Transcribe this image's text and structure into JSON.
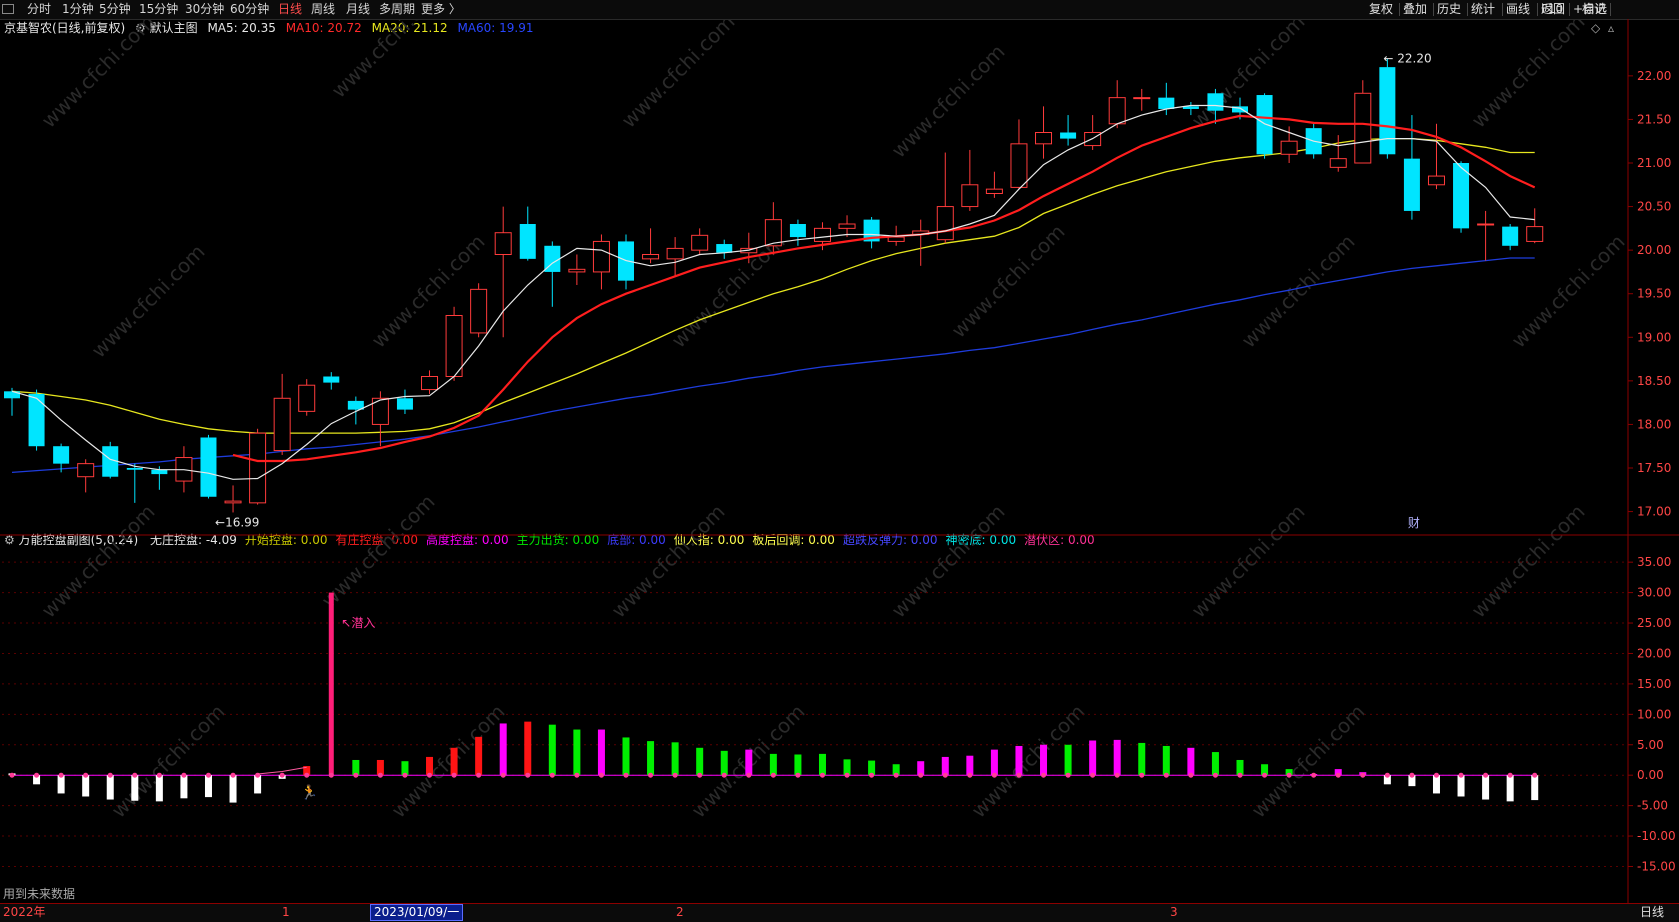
{
  "toolbar": {
    "tabs": [
      "分时",
      "1分钟",
      "5分钟",
      "15分钟",
      "30分钟",
      "60分钟",
      "日线",
      "周线",
      "月线",
      "多周期",
      "更多 〉"
    ],
    "active_tab": "日线",
    "right_buttons": [
      "复权",
      "叠加",
      "历史",
      "统计",
      "画线",
      "F10",
      "+自选",
      "返回"
    ],
    "extra_button": "标记"
  },
  "main_legend": {
    "stock": "京基智农(日线,前复权)",
    "template": "默认主图",
    "ma5_label": "MA5: 20.35",
    "ma10_label": "MA10: 20.72",
    "ma20_label": "MA20: 21.12",
    "ma60_label": "MA60: 19.91"
  },
  "colors": {
    "up": "#ff3b3b",
    "down": "#00e5ff",
    "ma5": "#e8e8e8",
    "ma10": "#ff1e1e",
    "ma20": "#e6e61e",
    "ma60": "#1e3cdc",
    "axis": "#8b0000",
    "axis_text": "#ff4646",
    "green_bar": "#00f000",
    "magenta_bar": "#ff00ff",
    "red_bar": "#ff1414"
  },
  "sub_legend": {
    "name": "万能控盘副图(5,0.24)",
    "items": [
      {
        "label": "无庄控盘: -4.09",
        "color": "#e6e6e6"
      },
      {
        "label": "开始控盘: 0.00",
        "color": "#c8c800"
      },
      {
        "label": "有庄控盘: 0.00",
        "color": "#ff2020"
      },
      {
        "label": "高度控盘: 0.00",
        "color": "#ff00ff"
      },
      {
        "label": "主力出货: 0.00",
        "color": "#00e600"
      },
      {
        "label": "底部: 0.00",
        "color": "#3c3cff"
      },
      {
        "label": "仙人指: 0.00",
        "color": "#ffff50"
      },
      {
        "label": "板后回调: 0.00",
        "color": "#ffff50"
      },
      {
        "label": "超跌反弹力: 0.00",
        "color": "#4646ff"
      },
      {
        "label": "神密底: 0.00",
        "color": "#00e6e6"
      },
      {
        "label": "潜伏区: 0.00",
        "color": "#ff3296"
      }
    ]
  },
  "annotations": {
    "high_label": "22.20",
    "low_label": "←16.99",
    "cai_badge": "财",
    "qianru": "↖潜入",
    "future_data": "用到未来数据"
  },
  "watermark": "www.cfchi.com",
  "bottom_bar": {
    "year": "2022年",
    "m1": "1",
    "date_box": "2023/01/09/一",
    "m2": "2",
    "m3": "3",
    "period": "日线"
  },
  "chart_data": [
    {
      "type": "candlestick",
      "title": "京基智农(日线,前复权)",
      "ylim": [
        16.8,
        22.4
      ],
      "yticks": [
        "17.00",
        "17.50",
        "18.00",
        "18.50",
        "19.00",
        "19.50",
        "20.00",
        "20.50",
        "21.00",
        "21.50",
        "22.00"
      ],
      "candles": [
        {
          "o": 18.38,
          "c": 18.3,
          "h": 18.42,
          "l": 18.1
        },
        {
          "o": 18.35,
          "c": 17.75,
          "h": 18.4,
          "l": 17.7
        },
        {
          "o": 17.75,
          "c": 17.55,
          "h": 17.78,
          "l": 17.45
        },
        {
          "o": 17.4,
          "c": 17.55,
          "h": 17.6,
          "l": 17.22
        },
        {
          "o": 17.75,
          "c": 17.4,
          "h": 17.8,
          "l": 17.38
        },
        {
          "o": 17.5,
          "c": 17.48,
          "h": 17.55,
          "l": 17.1
        },
        {
          "o": 17.48,
          "c": 17.43,
          "h": 17.52,
          "l": 17.25
        },
        {
          "o": 17.35,
          "c": 17.62,
          "h": 17.75,
          "l": 17.22
        },
        {
          "o": 17.85,
          "c": 17.17,
          "h": 17.88,
          "l": 17.15
        },
        {
          "o": 17.1,
          "c": 17.12,
          "h": 17.3,
          "l": 16.99
        },
        {
          "o": 17.1,
          "c": 17.9,
          "h": 17.95,
          "l": 17.08
        },
        {
          "o": 17.7,
          "c": 18.3,
          "h": 18.58,
          "l": 17.65
        },
        {
          "o": 18.15,
          "c": 18.45,
          "h": 18.52,
          "l": 18.1
        },
        {
          "o": 18.55,
          "c": 18.48,
          "h": 18.6,
          "l": 18.4
        },
        {
          "o": 18.27,
          "c": 18.17,
          "h": 18.32,
          "l": 18.0
        },
        {
          "o": 18.0,
          "c": 18.3,
          "h": 18.38,
          "l": 17.75
        },
        {
          "o": 18.3,
          "c": 18.17,
          "h": 18.4,
          "l": 18.12
        },
        {
          "o": 18.4,
          "c": 18.55,
          "h": 18.62,
          "l": 18.35
        },
        {
          "o": 18.55,
          "c": 19.25,
          "h": 19.35,
          "l": 18.5
        },
        {
          "o": 19.05,
          "c": 19.55,
          "h": 19.62,
          "l": 19.0
        },
        {
          "o": 19.95,
          "c": 20.2,
          "h": 20.5,
          "l": 19.0
        },
        {
          "o": 20.3,
          "c": 19.9,
          "h": 20.5,
          "l": 19.88
        },
        {
          "o": 20.05,
          "c": 19.75,
          "h": 20.1,
          "l": 19.35
        },
        {
          "o": 19.75,
          "c": 19.78,
          "h": 19.95,
          "l": 19.6
        },
        {
          "o": 19.75,
          "c": 20.1,
          "h": 20.18,
          "l": 19.55
        },
        {
          "o": 20.1,
          "c": 19.65,
          "h": 20.18,
          "l": 19.55
        },
        {
          "o": 19.9,
          "c": 19.95,
          "h": 20.25,
          "l": 19.85
        },
        {
          "o": 19.9,
          "c": 20.02,
          "h": 20.15,
          "l": 19.7
        },
        {
          "o": 20.0,
          "c": 20.17,
          "h": 20.25,
          "l": 19.95
        },
        {
          "o": 20.07,
          "c": 19.97,
          "h": 20.12,
          "l": 19.9
        },
        {
          "o": 19.97,
          "c": 20.02,
          "h": 20.2,
          "l": 19.85
        },
        {
          "o": 20.05,
          "c": 20.35,
          "h": 20.55,
          "l": 19.95
        },
        {
          "o": 20.3,
          "c": 20.15,
          "h": 20.35,
          "l": 20.05
        },
        {
          "o": 20.1,
          "c": 20.25,
          "h": 20.32,
          "l": 20.0
        },
        {
          "o": 20.25,
          "c": 20.3,
          "h": 20.4,
          "l": 20.15
        },
        {
          "o": 20.35,
          "c": 20.1,
          "h": 20.38,
          "l": 20.02
        },
        {
          "o": 20.1,
          "c": 20.15,
          "h": 20.28,
          "l": 20.05
        },
        {
          "o": 20.18,
          "c": 20.22,
          "h": 20.35,
          "l": 19.82
        },
        {
          "o": 20.12,
          "c": 20.5,
          "h": 21.12,
          "l": 20.08
        },
        {
          "o": 20.5,
          "c": 20.75,
          "h": 21.15,
          "l": 20.45
        },
        {
          "o": 20.65,
          "c": 20.7,
          "h": 20.9,
          "l": 20.6
        },
        {
          "o": 20.72,
          "c": 21.22,
          "h": 21.5,
          "l": 20.7
        },
        {
          "o": 21.22,
          "c": 21.35,
          "h": 21.65,
          "l": 21.05
        },
        {
          "o": 21.35,
          "c": 21.28,
          "h": 21.55,
          "l": 21.2
        },
        {
          "o": 21.2,
          "c": 21.35,
          "h": 21.55,
          "l": 21.15
        },
        {
          "o": 21.45,
          "c": 21.75,
          "h": 21.95,
          "l": 21.4
        },
        {
          "o": 21.75,
          "c": 21.75,
          "h": 21.85,
          "l": 21.6
        },
        {
          "o": 21.75,
          "c": 21.62,
          "h": 21.92,
          "l": 21.55
        },
        {
          "o": 21.65,
          "c": 21.62,
          "h": 21.7,
          "l": 21.55
        },
        {
          "o": 21.8,
          "c": 21.6,
          "h": 21.85,
          "l": 21.45
        },
        {
          "o": 21.65,
          "c": 21.58,
          "h": 21.75,
          "l": 21.5
        },
        {
          "o": 21.78,
          "c": 21.1,
          "h": 21.8,
          "l": 21.05
        },
        {
          "o": 21.1,
          "c": 21.25,
          "h": 21.42,
          "l": 21.0
        },
        {
          "o": 21.4,
          "c": 21.1,
          "h": 21.45,
          "l": 21.05
        },
        {
          "o": 20.95,
          "c": 21.05,
          "h": 21.32,
          "l": 20.9
        },
        {
          "o": 21.0,
          "c": 21.8,
          "h": 21.95,
          "l": 21.0
        },
        {
          "o": 22.1,
          "c": 21.1,
          "h": 22.2,
          "l": 21.05
        },
        {
          "o": 21.05,
          "c": 20.45,
          "h": 21.55,
          "l": 20.35
        },
        {
          "o": 20.75,
          "c": 20.85,
          "h": 21.45,
          "l": 20.7
        },
        {
          "o": 21.0,
          "c": 20.25,
          "h": 21.02,
          "l": 20.2
        },
        {
          "o": 20.3,
          "c": 20.3,
          "h": 20.45,
          "l": 19.88
        },
        {
          "o": 20.27,
          "c": 20.05,
          "h": 20.3,
          "l": 20.0
        },
        {
          "o": 20.1,
          "c": 20.27,
          "h": 20.48,
          "l": 20.08
        }
      ],
      "ma5": [
        18.38,
        18.3,
        18.05,
        17.82,
        17.6,
        17.52,
        17.48,
        17.48,
        17.44,
        17.37,
        17.38,
        17.55,
        17.77,
        18.01,
        18.15,
        18.28,
        18.32,
        18.33,
        18.55,
        18.9,
        19.3,
        19.6,
        19.85,
        20.02,
        20.0,
        19.88,
        19.82,
        19.86,
        19.95,
        19.97,
        20.0,
        20.08,
        20.12,
        20.15,
        20.18,
        20.18,
        20.16,
        20.18,
        20.22,
        20.3,
        20.4,
        20.7,
        20.98,
        21.15,
        21.28,
        21.45,
        21.55,
        21.62,
        21.66,
        21.66,
        21.63,
        21.45,
        21.35,
        21.25,
        21.2,
        21.24,
        21.28,
        21.28,
        21.25,
        20.95,
        20.72,
        20.38,
        20.35
      ],
      "ma10": [
        null,
        null,
        null,
        null,
        null,
        null,
        null,
        null,
        null,
        17.65,
        17.58,
        17.58,
        17.6,
        17.64,
        17.68,
        17.73,
        17.8,
        17.86,
        17.96,
        18.1,
        18.4,
        18.72,
        19.0,
        19.22,
        19.38,
        19.5,
        19.6,
        19.7,
        19.8,
        19.86,
        19.92,
        19.97,
        20.02,
        20.06,
        20.1,
        20.14,
        20.16,
        20.18,
        20.22,
        20.26,
        20.34,
        20.46,
        20.62,
        20.76,
        20.9,
        21.06,
        21.2,
        21.3,
        21.4,
        21.48,
        21.54,
        21.52,
        21.5,
        21.46,
        21.45,
        21.45,
        21.42,
        21.38,
        21.3,
        21.18,
        21.02,
        20.85,
        20.72
      ],
      "ma20": [
        18.38,
        18.36,
        18.32,
        18.28,
        18.22,
        18.14,
        18.06,
        18.0,
        17.95,
        17.92,
        17.9,
        17.9,
        17.9,
        17.9,
        17.9,
        17.91,
        17.92,
        17.95,
        18.02,
        18.13,
        18.25,
        18.36,
        18.47,
        18.58,
        18.7,
        18.82,
        18.95,
        19.08,
        19.2,
        19.3,
        19.4,
        19.5,
        19.58,
        19.67,
        19.78,
        19.88,
        19.96,
        20.02,
        20.08,
        20.12,
        20.16,
        20.26,
        20.42,
        20.53,
        20.64,
        20.74,
        20.82,
        20.9,
        20.96,
        21.02,
        21.06,
        21.09,
        21.12,
        21.17,
        21.23,
        21.27,
        21.28,
        21.28,
        21.26,
        21.22,
        21.18,
        21.12,
        21.12
      ],
      "ma60": [
        17.45,
        17.47,
        17.49,
        17.51,
        17.53,
        17.55,
        17.57,
        17.6,
        17.62,
        17.64,
        17.66,
        17.69,
        17.72,
        17.74,
        17.77,
        17.8,
        17.83,
        17.87,
        17.92,
        17.97,
        18.03,
        18.09,
        18.15,
        18.2,
        18.25,
        18.3,
        18.34,
        18.39,
        18.44,
        18.48,
        18.53,
        18.57,
        18.62,
        18.66,
        18.69,
        18.72,
        18.75,
        18.78,
        18.81,
        18.85,
        18.88,
        18.93,
        18.98,
        19.03,
        19.09,
        19.15,
        19.2,
        19.26,
        19.32,
        19.38,
        19.43,
        19.49,
        19.54,
        19.6,
        19.65,
        19.7,
        19.75,
        19.79,
        19.82,
        19.85,
        19.88,
        19.91,
        19.91
      ]
    },
    {
      "type": "bar",
      "title": "万能控盘副图(5,0.24)",
      "ylim": [
        -21,
        37
      ],
      "yticks": [
        "-15.00",
        "-10.00",
        "-5.00",
        "0.00",
        "5.00",
        "10.00",
        "15.00",
        "20.00",
        "25.00",
        "30.00",
        "35.00"
      ],
      "bars": [
        {
          "v": 0.3,
          "c": "white"
        },
        {
          "v": -1.5,
          "c": "white"
        },
        {
          "v": -3.0,
          "c": "white"
        },
        {
          "v": -3.5,
          "c": "white"
        },
        {
          "v": -4.0,
          "c": "white"
        },
        {
          "v": -4.2,
          "c": "white"
        },
        {
          "v": -4.3,
          "c": "white"
        },
        {
          "v": -3.8,
          "c": "white"
        },
        {
          "v": -3.6,
          "c": "white"
        },
        {
          "v": -4.5,
          "c": "white"
        },
        {
          "v": -3.0,
          "c": "white"
        },
        {
          "v": -0.6,
          "c": "white"
        },
        {
          "v": 1.5,
          "c": "red"
        },
        {
          "v": 30.0,
          "c": "pink"
        },
        {
          "v": 2.5,
          "c": "green"
        },
        {
          "v": 2.5,
          "c": "red"
        },
        {
          "v": 2.3,
          "c": "green"
        },
        {
          "v": 3.0,
          "c": "red"
        },
        {
          "v": 4.5,
          "c": "red"
        },
        {
          "v": 6.3,
          "c": "red"
        },
        {
          "v": 8.5,
          "c": "magenta"
        },
        {
          "v": 8.8,
          "c": "red"
        },
        {
          "v": 8.3,
          "c": "green"
        },
        {
          "v": 7.5,
          "c": "green"
        },
        {
          "v": 7.5,
          "c": "magenta"
        },
        {
          "v": 6.2,
          "c": "green"
        },
        {
          "v": 5.6,
          "c": "green"
        },
        {
          "v": 5.4,
          "c": "green"
        },
        {
          "v": 4.5,
          "c": "green"
        },
        {
          "v": 4.0,
          "c": "green"
        },
        {
          "v": 4.2,
          "c": "magenta"
        },
        {
          "v": 3.5,
          "c": "green"
        },
        {
          "v": 3.4,
          "c": "green"
        },
        {
          "v": 3.5,
          "c": "green"
        },
        {
          "v": 2.6,
          "c": "green"
        },
        {
          "v": 2.4,
          "c": "green"
        },
        {
          "v": 1.8,
          "c": "green"
        },
        {
          "v": 2.3,
          "c": "magenta"
        },
        {
          "v": 3.0,
          "c": "magenta"
        },
        {
          "v": 3.2,
          "c": "magenta"
        },
        {
          "v": 4.2,
          "c": "magenta"
        },
        {
          "v": 4.8,
          "c": "magenta"
        },
        {
          "v": 5.0,
          "c": "magenta"
        },
        {
          "v": 5.0,
          "c": "green"
        },
        {
          "v": 5.7,
          "c": "magenta"
        },
        {
          "v": 5.8,
          "c": "magenta"
        },
        {
          "v": 5.3,
          "c": "green"
        },
        {
          "v": 4.8,
          "c": "green"
        },
        {
          "v": 4.5,
          "c": "magenta"
        },
        {
          "v": 3.8,
          "c": "green"
        },
        {
          "v": 2.5,
          "c": "green"
        },
        {
          "v": 1.8,
          "c": "green"
        },
        {
          "v": 1.0,
          "c": "green"
        },
        {
          "v": 0.2,
          "c": "magenta"
        },
        {
          "v": 1.0,
          "c": "magenta"
        },
        {
          "v": 0.5,
          "c": "magenta"
        },
        {
          "v": -1.5,
          "c": "white"
        },
        {
          "v": -1.8,
          "c": "white"
        },
        {
          "v": -3.0,
          "c": "white"
        },
        {
          "v": -3.5,
          "c": "white"
        },
        {
          "v": -4.0,
          "c": "white"
        },
        {
          "v": -4.3,
          "c": "white"
        },
        {
          "v": -4.09,
          "c": "white"
        }
      ]
    }
  ]
}
